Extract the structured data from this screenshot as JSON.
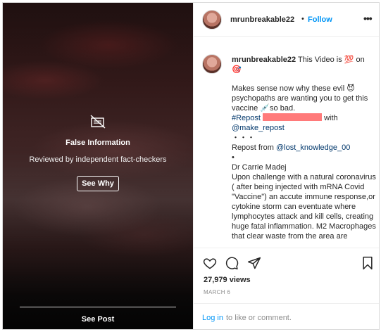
{
  "fact_check": {
    "title": "False Information",
    "subtitle": "Reviewed by independent fact-checkers",
    "button": "See Why",
    "see_post": "See Post",
    "icon": "hidden-media-icon"
  },
  "header": {
    "username": "mrunbreakable22",
    "separator": "•",
    "follow": "Follow",
    "more": "•••"
  },
  "caption": {
    "username": "mrunbreakable22",
    "line1": "This Video is 💯 on 🎯",
    "line2": "Makes sense now why these evil 😈 psychopaths are wanting you to get this vaccine 💉so bad.",
    "repost_tag": "#Repost",
    "with": "with",
    "make_repost": "@make_repost",
    "dots": "・・・",
    "repost_from": "Repost from",
    "lost_knowledge": "@lost_knowledge_00",
    "bullet": "•",
    "name": "Dr Carrie Madej",
    "body": "Upon challenge with a natural coronavirus ( after being injected with mRNA Covid \"Vaccine\") an accute immune response,or cytokine storm can eventuate where lymphocytes attack and kill cells, creating huge fatal inflammation. M2 Macrophages that clear waste from the area are"
  },
  "stats": {
    "views": "27,979 views",
    "date": "MARCH 6"
  },
  "login": {
    "link": "Log in",
    "rest": "to like or comment."
  },
  "colors": {
    "accent": "#0095f6",
    "redaction": "#ff6b6b"
  }
}
